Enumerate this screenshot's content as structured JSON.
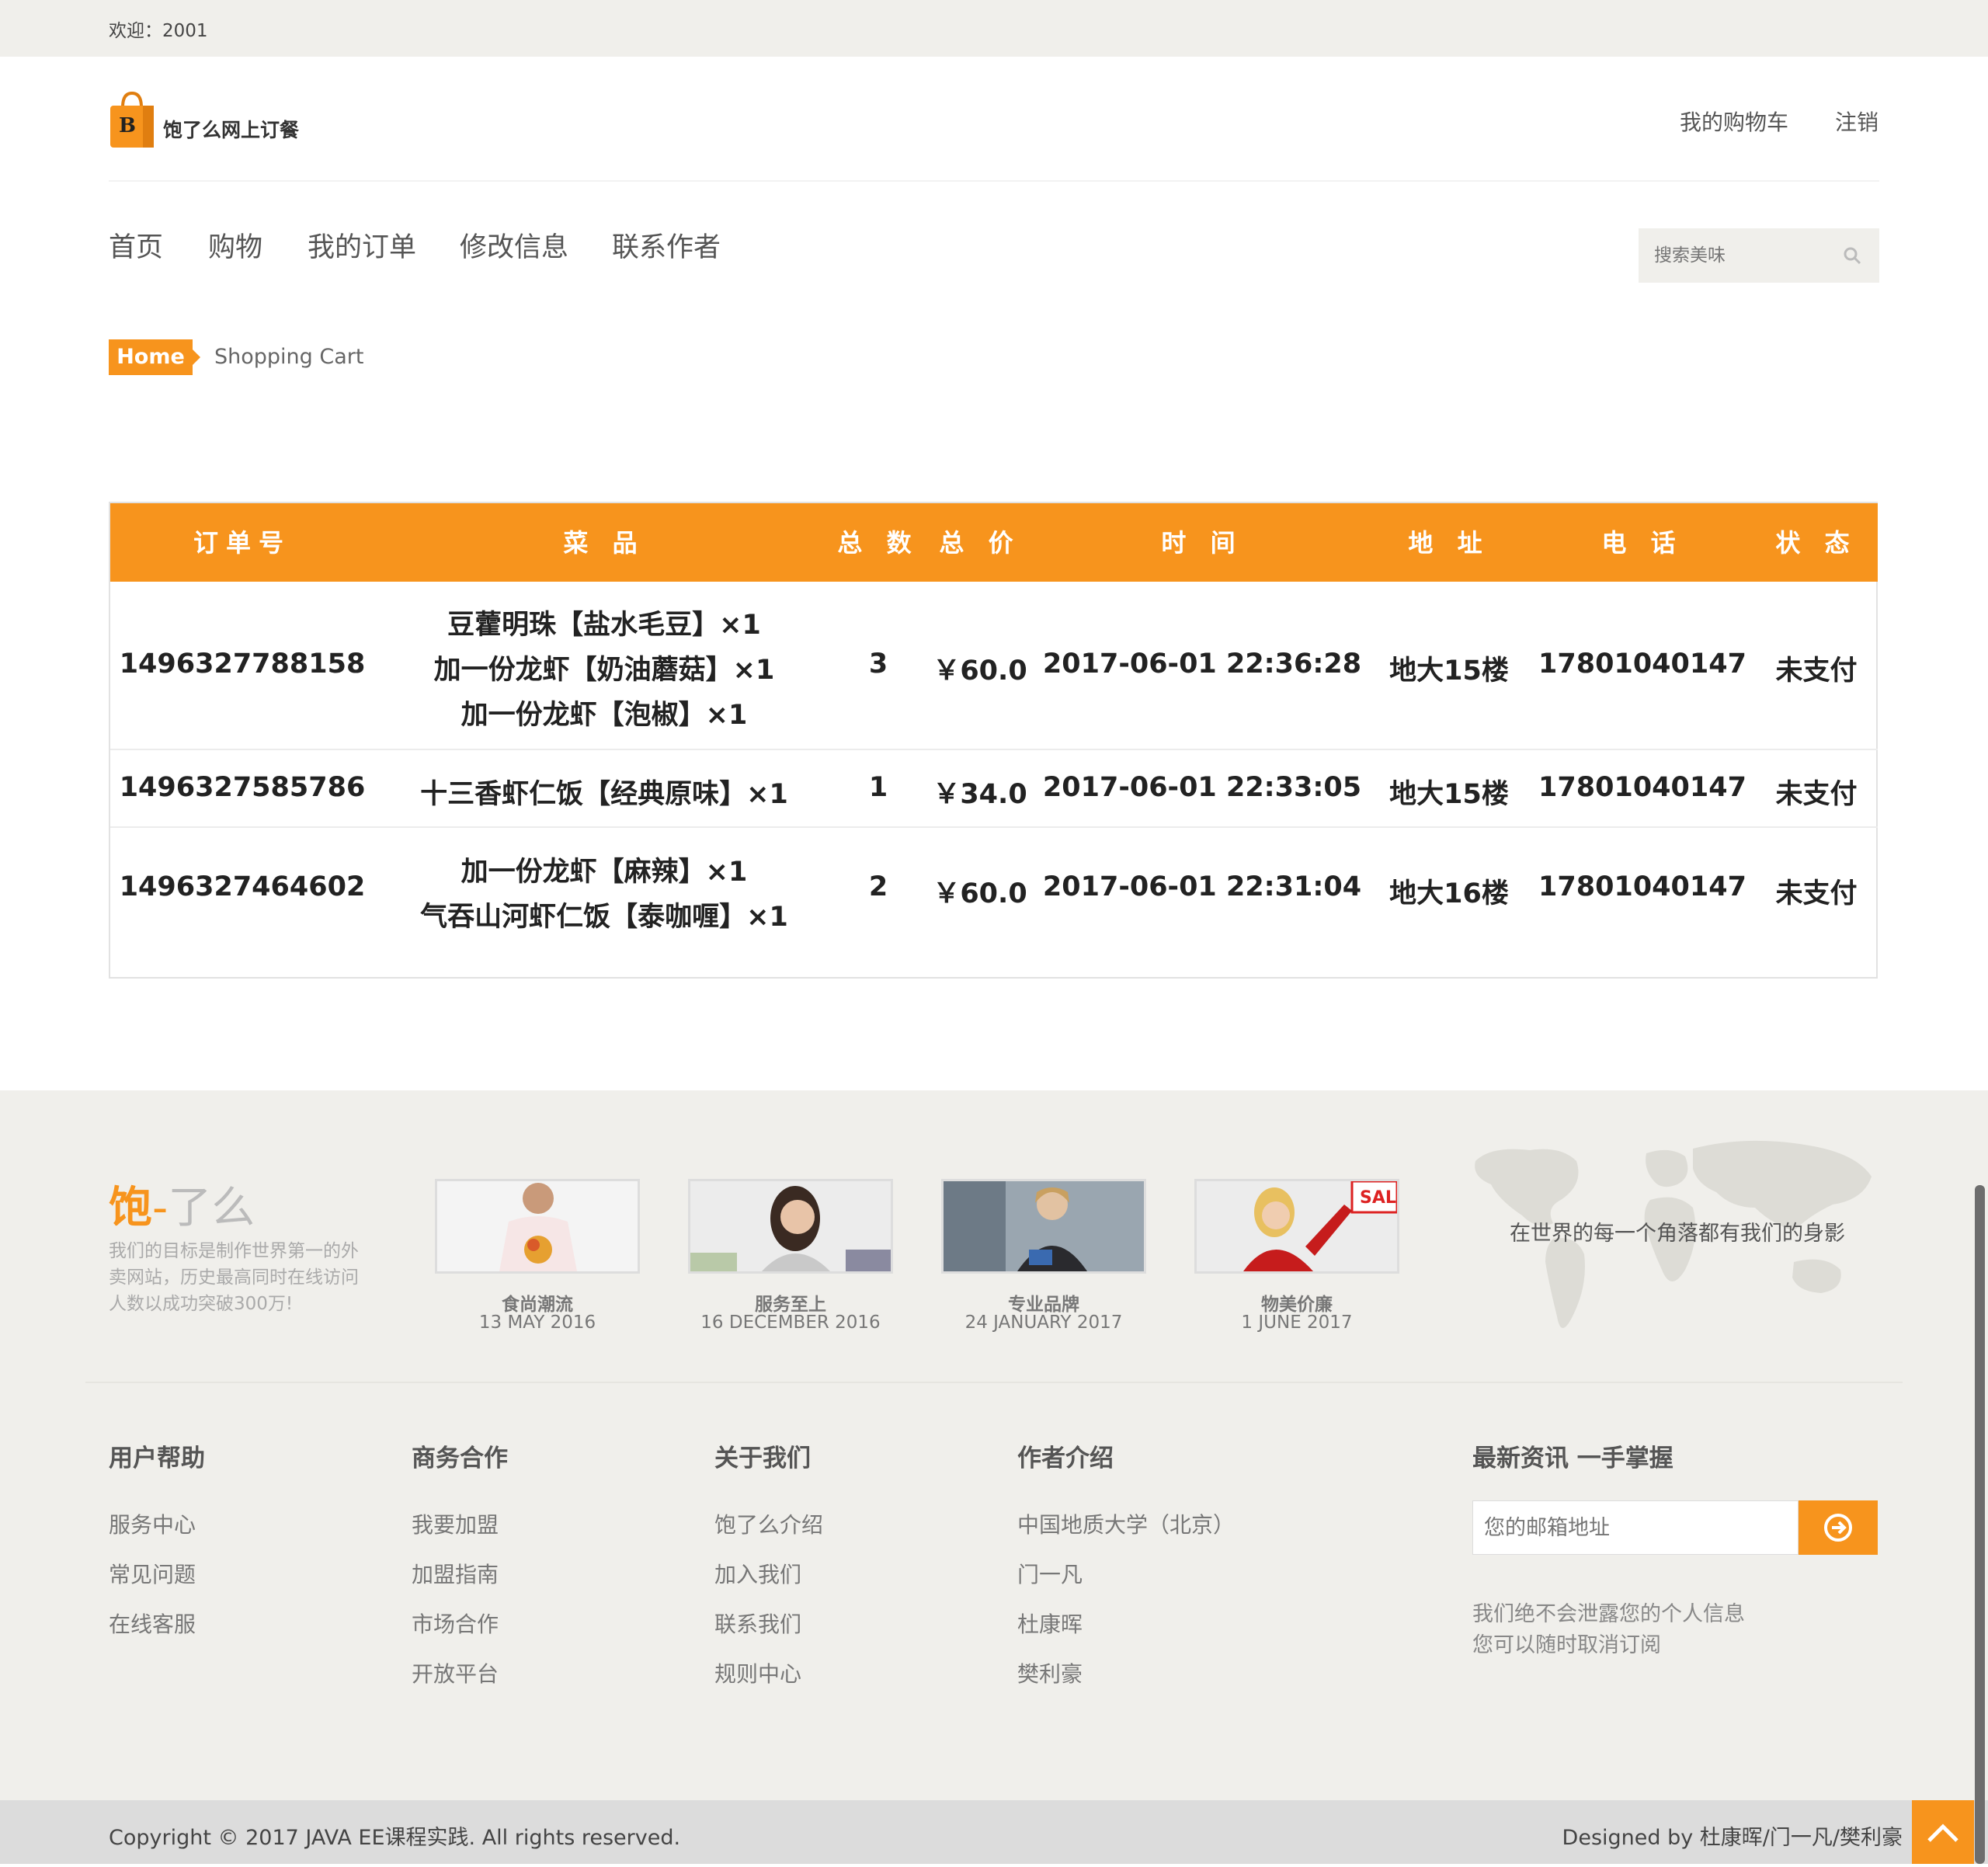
{
  "topbar": {
    "welcome": "欢迎：2001"
  },
  "header": {
    "logo_letter": "B",
    "logo_text": "饱了么网上订餐",
    "cart_link": "我的购物车",
    "logout_link": "注销"
  },
  "nav": {
    "items": [
      {
        "label": "首页"
      },
      {
        "label": "购物"
      },
      {
        "label": "我的订单"
      },
      {
        "label": "修改信息"
      },
      {
        "label": "联系作者"
      }
    ],
    "search_placeholder": "搜索美味"
  },
  "breadcrumb": {
    "home": "Home",
    "current": "Shopping Cart"
  },
  "orders": {
    "headers": [
      "订单号",
      "菜 品",
      "总 数",
      "总 价",
      "时 间",
      "地 址",
      "电 话",
      "状 态"
    ],
    "rows": [
      {
        "id": "1496327788158",
        "dishes": [
          "豆藿明珠【盐水毛豆】×1",
          "加一份龙虾【奶油蘑菇】×1",
          "加一份龙虾【泡椒】×1"
        ],
        "count": "3",
        "price": "￥60.0",
        "time": "2017-06-01 22:36:28",
        "address": "地大15楼",
        "phone": "17801040147",
        "status": "未支付"
      },
      {
        "id": "1496327585786",
        "dishes": [
          "十三香虾仁饭【经典原味】×1"
        ],
        "count": "1",
        "price": "￥34.0",
        "time": "2017-06-01 22:33:05",
        "address": "地大15楼",
        "phone": "17801040147",
        "status": "未支付"
      },
      {
        "id": "1496327464602",
        "dishes": [
          "加一份龙虾【麻辣】×1",
          "气吞山河虾仁饭【泰咖喱】×1"
        ],
        "count": "2",
        "price": "￥60.0",
        "time": "2017-06-01 22:31:04",
        "address": "地大16楼",
        "phone": "17801040147",
        "status": "未支付"
      }
    ]
  },
  "footer": {
    "brand_bao": "饱",
    "brand_dash": "-",
    "brand_rest": "了么",
    "brand_desc": "我们的目标是制作世界第一的外卖网站，历史最高同时在线访问人数以成功突破300万!",
    "gallery": [
      {
        "caption": "食尚潮流",
        "date": "13 MAY 2016"
      },
      {
        "caption": "服务至上",
        "date": "16 DECEMBER 2016"
      },
      {
        "caption": "专业品牌",
        "date": "24 JANUARY 2017"
      },
      {
        "caption": "物美价廉",
        "date": "1 JUNE 2017"
      }
    ],
    "sale_text": "SAL",
    "map_text": "在世界的每一个角落都有我们的身影",
    "columns": [
      {
        "title": "用户帮助",
        "links": [
          "服务中心",
          "常见问题",
          "在线客服"
        ]
      },
      {
        "title": "商务合作",
        "links": [
          "我要加盟",
          "加盟指南",
          "市场合作",
          "开放平台"
        ]
      },
      {
        "title": "关于我们",
        "links": [
          "饱了么介绍",
          "加入我们",
          "联系我们",
          "规则中心"
        ]
      },
      {
        "title": "作者介绍",
        "links": [
          "中国地质大学（北京）",
          "门一凡",
          "杜康晖",
          "樊利豪"
        ]
      }
    ],
    "newsletter_title": "最新资讯 一手掌握",
    "email_placeholder": "您的邮箱地址",
    "privacy_line1": "我们绝不会泄露您的个人信息",
    "privacy_line2": "您可以随时取消订阅"
  },
  "bottom": {
    "copyright": "Copyright © 2017 JAVA EE课程实践. All rights reserved.",
    "designed": "Designed by 杜康晖/门一凡/樊利豪"
  },
  "colors": {
    "accent": "#f7941d",
    "topbar": "#f0efeb",
    "footer": "#f0efeb"
  }
}
